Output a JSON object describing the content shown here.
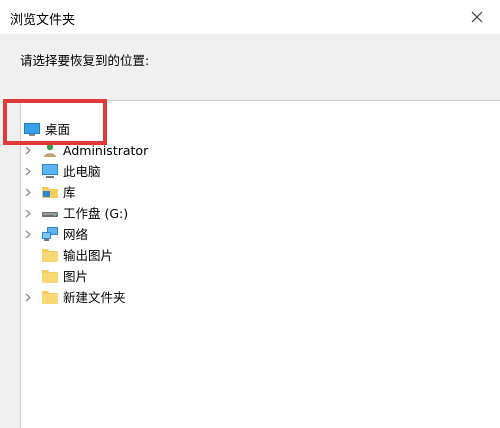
{
  "window": {
    "title": "浏览文件夹",
    "close_icon": "close-icon"
  },
  "prompt": "请选择要恢复到的位置:",
  "tree": {
    "items": [
      {
        "label": "桌面",
        "icon": "desktop-icon",
        "expandable": false,
        "selected": true
      },
      {
        "label": "Administrator",
        "icon": "user-icon",
        "expandable": true
      },
      {
        "label": "此电脑",
        "icon": "computer-icon",
        "expandable": true
      },
      {
        "label": "库",
        "icon": "library-folder-icon",
        "expandable": true
      },
      {
        "label": "工作盘 (G:)",
        "icon": "drive-icon",
        "expandable": true
      },
      {
        "label": "网络",
        "icon": "network-icon",
        "expandable": true
      },
      {
        "label": "输出图片",
        "icon": "folder-icon",
        "expandable": false
      },
      {
        "label": "图片",
        "icon": "folder-icon",
        "expandable": false
      },
      {
        "label": "新建文件夹",
        "icon": "folder-icon",
        "expandable": true
      }
    ]
  },
  "colors": {
    "highlight": "#e03a3a",
    "folder": "#f5cd5d",
    "desktop": "#1a7fd0"
  }
}
